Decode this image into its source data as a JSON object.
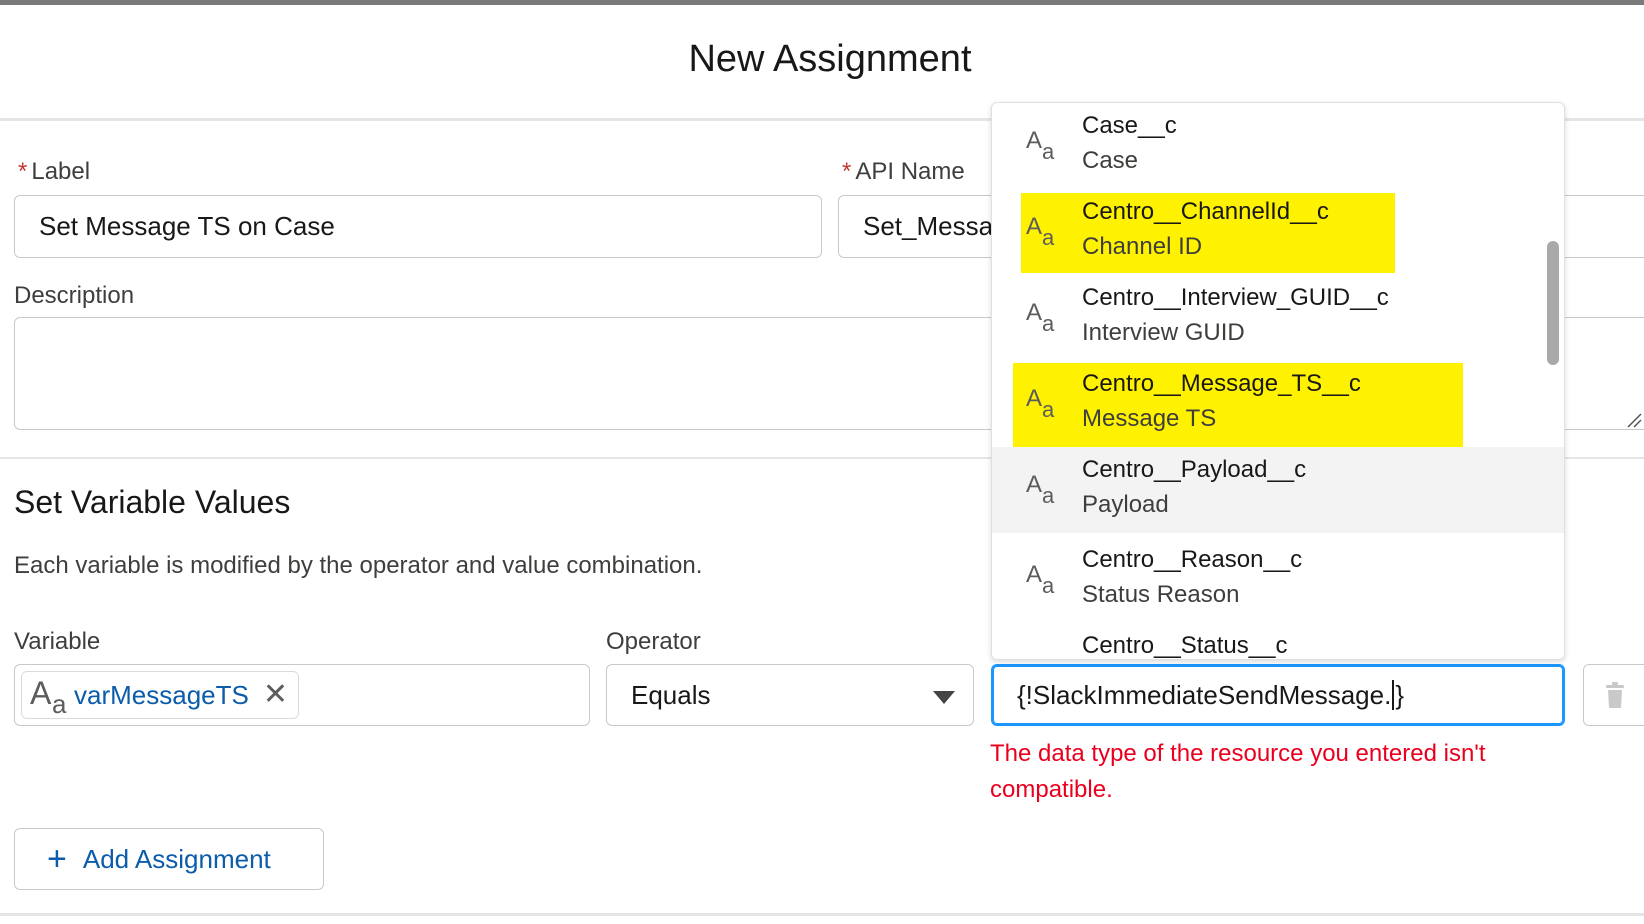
{
  "dialog": {
    "title": "New Assignment"
  },
  "form": {
    "label_label": "Label",
    "label_value": "Set Message TS on Case",
    "api_name_label": "API Name",
    "api_name_value": "Set_Messa",
    "description_label": "Description",
    "description_value": ""
  },
  "section": {
    "title": "Set Variable Values",
    "description": "Each variable is modified by the operator and value combination."
  },
  "assignment": {
    "variable_label": "Variable",
    "variable_value": "varMessageTS",
    "operator_label": "Operator",
    "operator_value": "Equals",
    "value_text_before_caret": "{!SlackImmediateSendMessage.",
    "value_text_after_caret": "}",
    "error": "The data type of the resource you entered isn't compatible."
  },
  "add_button_label": "Add Assignment",
  "dropdown": {
    "highlight_color": "#fff200",
    "hover_color": "#f3f3f3",
    "items": [
      {
        "api": "Case__c",
        "label": "Case"
      },
      {
        "api": "Centro__ChannelId__c",
        "label": "Channel ID",
        "highlighted": true
      },
      {
        "api": "Centro__Interview_GUID__c",
        "label": "Interview GUID"
      },
      {
        "api": "Centro__Message_TS__c",
        "label": "Message TS",
        "highlighted": true
      },
      {
        "api": "Centro__Payload__c",
        "label": "Payload",
        "hovered": true
      },
      {
        "api": "Centro__Reason__c",
        "label": "Status Reason"
      },
      {
        "api": "Centro__Status__c",
        "label": ""
      }
    ]
  },
  "colors": {
    "link": "#0b5cab",
    "error": "#ea001e",
    "focus": "#1b96ff",
    "required": "#c23934"
  },
  "icons": {
    "text_type": "text-type-icon",
    "remove": "close-icon",
    "delete": "trash-icon",
    "add": "plus-icon",
    "dropdown": "chevron-down-icon"
  }
}
